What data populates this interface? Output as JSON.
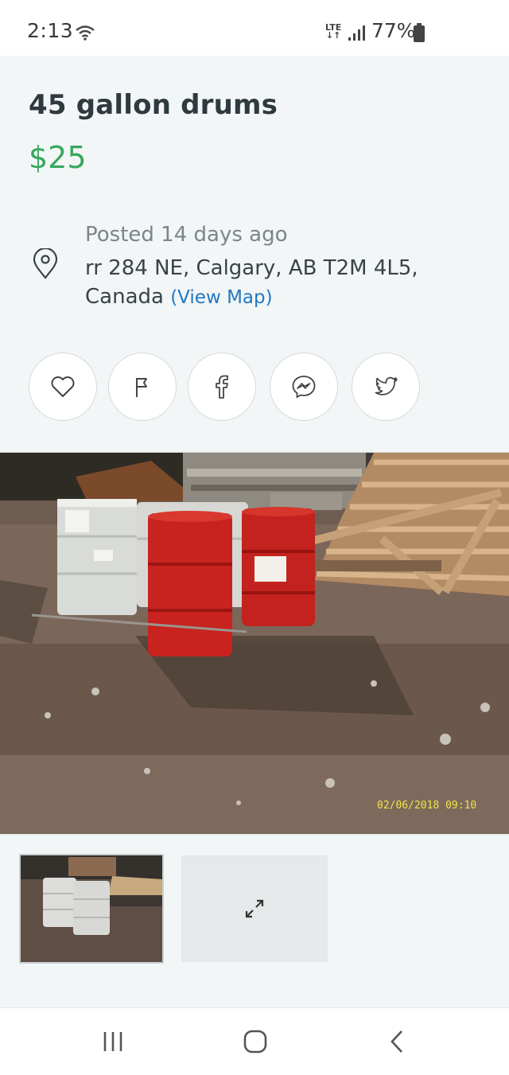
{
  "status": {
    "time": "2:13",
    "network": "LTE",
    "battery": "77%",
    "icons": [
      "wifi-icon",
      "signal-icon",
      "battery-icon"
    ]
  },
  "listing": {
    "title": "45 gallon drums",
    "price": "$25",
    "posted": "Posted 14 days ago",
    "address": "rr 284 NE, Calgary, AB T2M 4L5, Canada",
    "view_map": "(View Map)"
  },
  "share": [
    "favorite-icon",
    "report-flag-icon",
    "facebook-icon",
    "messenger-icon",
    "twitter-icon"
  ],
  "photo": {
    "stamp": "02/06/2018 09:10"
  },
  "nav": [
    "recent-apps-icon",
    "home-icon",
    "back-icon"
  ],
  "colors": {
    "price": "#37a85d",
    "link": "#1f78c4",
    "title": "#2f3a3f"
  }
}
